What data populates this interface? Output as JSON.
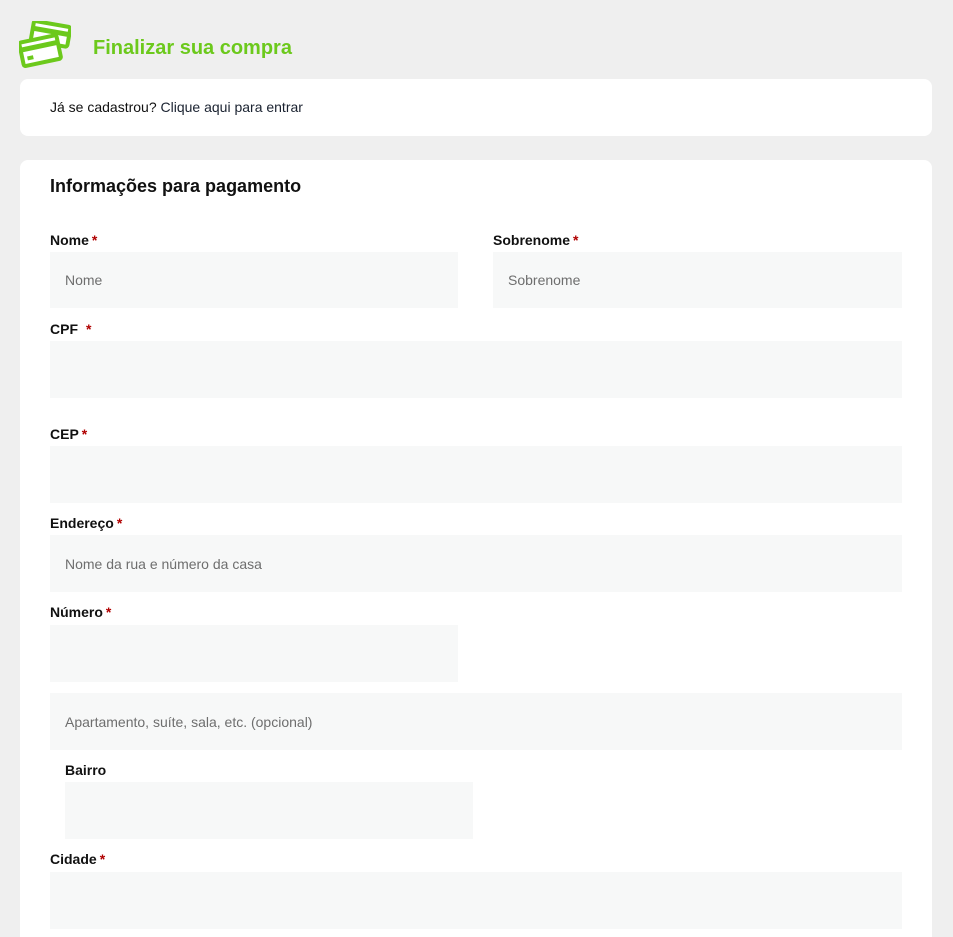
{
  "header": {
    "title": "Finalizar sua compra",
    "icon": "credit-cards-icon",
    "accent_color": "#6cc91c"
  },
  "login": {
    "prompt": "Já se cadastrou?",
    "link": "Clique aqui para entrar"
  },
  "form": {
    "section_title": "Informações para pagamento",
    "required_mark": "*",
    "fields": {
      "nome": {
        "label": "Nome",
        "placeholder": "Nome",
        "value": ""
      },
      "sobrenome": {
        "label": "Sobrenome",
        "placeholder": "Sobrenome",
        "value": ""
      },
      "cpf": {
        "label": "CPF",
        "placeholder": "",
        "value": ""
      },
      "cep": {
        "label": "CEP",
        "placeholder": "",
        "value": ""
      },
      "endereco": {
        "label": "Endereço",
        "placeholder": "Nome da rua e número da casa",
        "value": ""
      },
      "numero": {
        "label": "Número",
        "placeholder": "",
        "value": ""
      },
      "complemento": {
        "placeholder": "Apartamento, suíte, sala, etc. (opcional)",
        "value": ""
      },
      "bairro": {
        "label": "Bairro",
        "placeholder": "",
        "value": ""
      },
      "cidade": {
        "label": "Cidade",
        "placeholder": "",
        "value": ""
      }
    }
  }
}
